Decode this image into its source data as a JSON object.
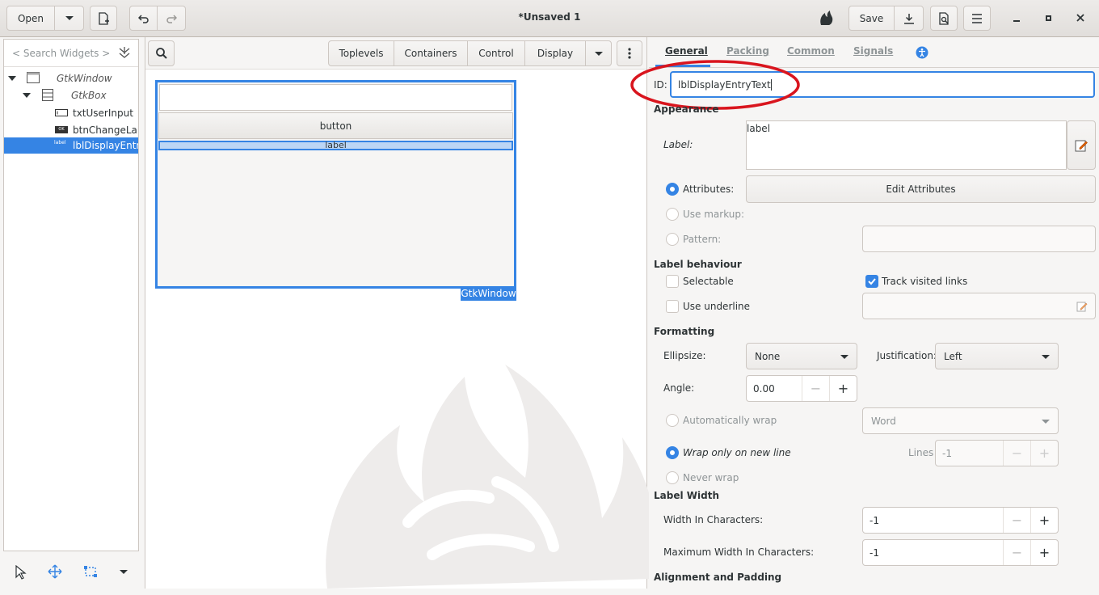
{
  "header": {
    "open_label": "Open",
    "title": "*Unsaved 1",
    "save_label": "Save"
  },
  "left_panel": {
    "search_placeholder": "< Search Widgets >",
    "tree": [
      {
        "label": "GtkWindow",
        "icon": "window-icon",
        "italic": true
      },
      {
        "label": "GtkBox",
        "icon": "box-icon",
        "italic": true
      },
      {
        "label": "txtUserInput",
        "icon": "entry-icon"
      },
      {
        "label": "btnChangeLabel",
        "icon": "button-icon"
      },
      {
        "label": "lblDisplayEntryText",
        "icon": "label-icon",
        "selected": true
      }
    ],
    "tree_icon_texts": {
      "button": "OK",
      "label": "label"
    }
  },
  "middle_panel": {
    "categories": [
      "Toplevels",
      "Containers",
      "Control",
      "Display"
    ],
    "preview": {
      "button_label": "button",
      "label_text": "label",
      "window_tag": "GtkWindow"
    }
  },
  "right_panel": {
    "tabs": [
      "General",
      "Packing",
      "Common",
      "Signals"
    ],
    "id_label": "ID:",
    "id_value": "lblDisplayEntryText",
    "appearance": {
      "title": "Appearance",
      "label_label": "Label:",
      "label_value": "label",
      "attributes_label": "Attributes:",
      "edit_attributes": "Edit Attributes",
      "use_markup": "Use markup:",
      "pattern": "Pattern:"
    },
    "label_behaviour": {
      "title": "Label behaviour",
      "selectable": "Selectable",
      "track_visited": "Track visited links",
      "use_underline": "Use underline"
    },
    "formatting": {
      "title": "Formatting",
      "ellipsize_label": "Ellipsize:",
      "ellipsize_value": "None",
      "justification_label": "Justification:",
      "justification_value": "Left",
      "angle_label": "Angle:",
      "angle_value": "0.00",
      "auto_wrap": "Automatically wrap",
      "wrap_mode_value": "Word",
      "wrap_new_line": "Wrap only on new line",
      "lines_label": "Lines",
      "lines_value": "-1",
      "never_wrap": "Never wrap"
    },
    "label_width": {
      "title": "Label Width",
      "width_chars_label": "Width In Characters:",
      "width_chars_value": "-1",
      "max_width_label": "Maximum Width In Characters:",
      "max_width_value": "-1"
    },
    "alignment_title": "Alignment and Padding"
  },
  "colors": {
    "accent": "#3584e4",
    "annotation": "#d9151e"
  }
}
